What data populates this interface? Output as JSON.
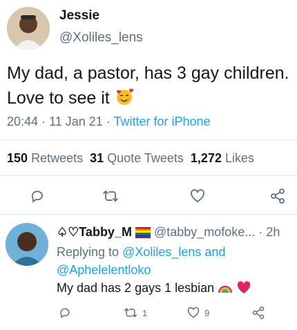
{
  "tweet": {
    "author_name": "Jessie",
    "author_handle": "@Xoliles_lens",
    "text": "My dad, a pastor, has 3 gay children. Love to see it",
    "time": "20:44",
    "date": "11 Jan 21",
    "separator": "·",
    "source": "Twitter for iPhone",
    "stats": {
      "retweets_count": "150",
      "retweets_label": "Retweets",
      "quote_count": "31",
      "quote_label": "Quote Tweets",
      "likes_count": "1,272",
      "likes_label": "Likes"
    },
    "actions": [
      "reply-icon",
      "retweet-icon",
      "like-icon",
      "share-icon"
    ]
  },
  "reply": {
    "author_name": "♤♡Tabby_M",
    "author_handle": "@tabby_mofoke...",
    "separator": "·",
    "time": "2h",
    "replying_prefix": "Replying to",
    "replying_user1": "@Xoliles_lens",
    "replying_and": "and",
    "replying_user2": "@Aphelelentloko",
    "text": "My dad has 2 gays 1 lesbian",
    "retweet_count": "1",
    "like_count": "9"
  },
  "colors": {
    "accent": "#1da1f2",
    "secondary_text": "#5b7083",
    "divider": "#e1e8ed",
    "heart": "#e0245e"
  }
}
